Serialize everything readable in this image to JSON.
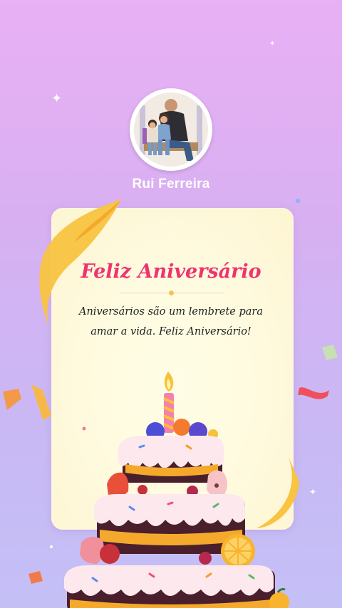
{
  "profile": {
    "name": "Rui Ferreira",
    "avatar_icon": "family-photo-icon"
  },
  "card": {
    "title": "Feliz Aniversário",
    "message": "Aniversários são um lembrete para amar a vida. Feliz Aniversário!"
  },
  "colors": {
    "title": "#f0336e",
    "background_top": "#e9b0f4",
    "background_bottom": "#c4c0f6",
    "card": "#fffbe0"
  },
  "decoration": {
    "cake_icon": "birthday-cake-icon",
    "candle_icon": "candle-icon",
    "ribbon_icon": "ribbon-icon",
    "confetti_icon": "confetti-icon"
  }
}
